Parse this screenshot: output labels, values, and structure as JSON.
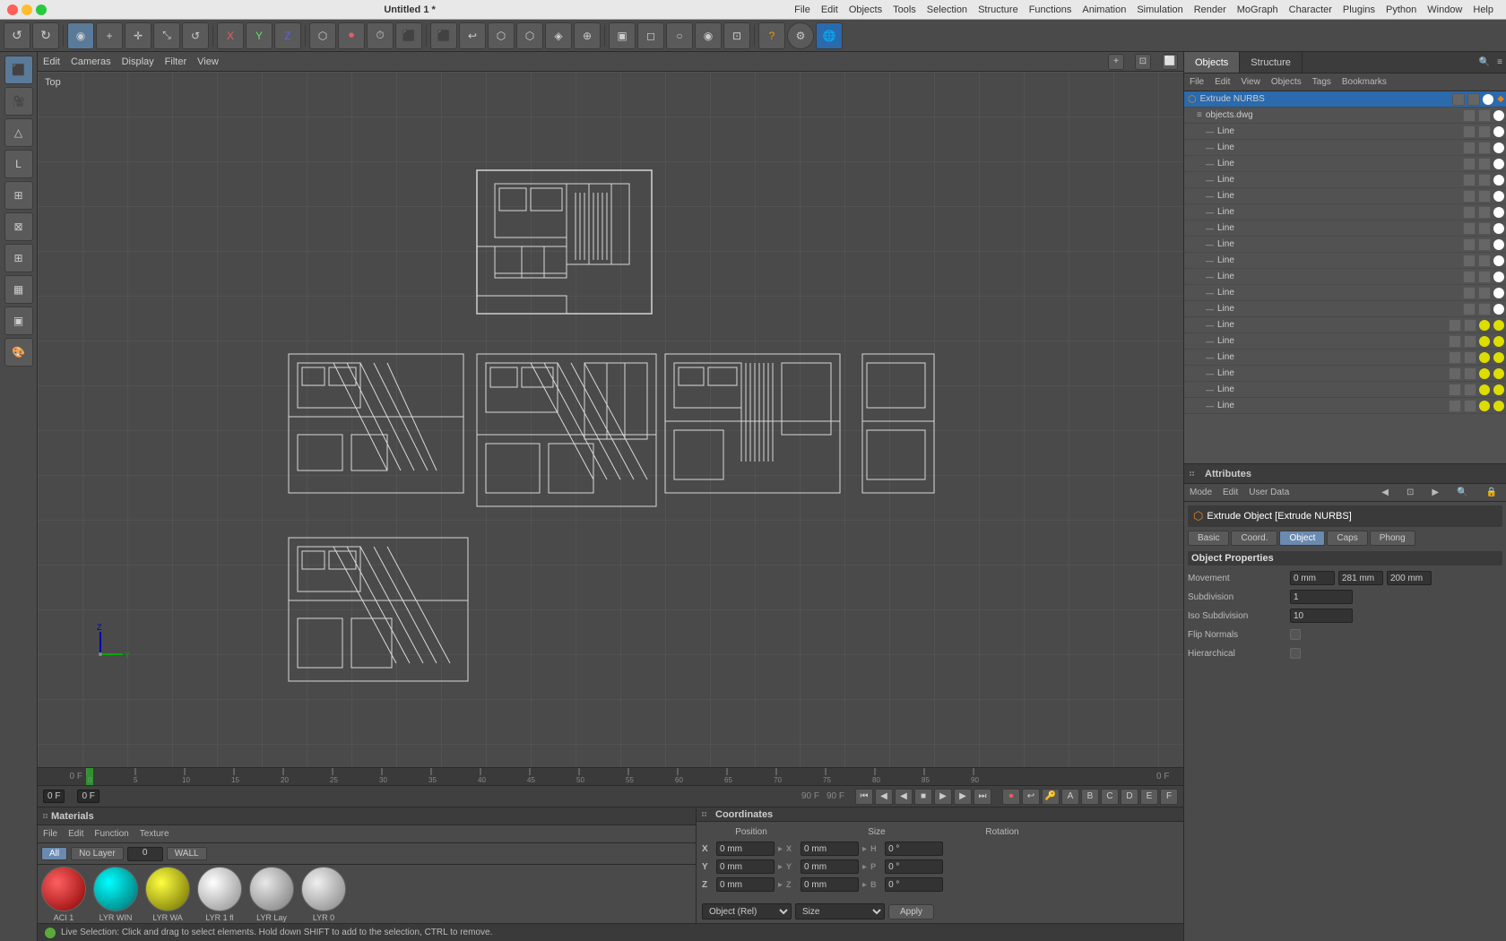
{
  "window": {
    "title": "Untitled 1 *",
    "close_label": "×",
    "minimize_label": "−",
    "maximize_label": "+"
  },
  "menu_bar": {
    "items": [
      "File",
      "Edit",
      "Objects",
      "Tools",
      "Selection",
      "Structure",
      "Functions",
      "Animation",
      "Simulation",
      "Render",
      "MoGraph",
      "Character",
      "Plugins",
      "Python",
      "Window",
      "Help"
    ]
  },
  "viewport": {
    "label": "Top",
    "toolbar_items": [
      "Edit",
      "Cameras",
      "Display",
      "Filter",
      "View"
    ]
  },
  "object_manager": {
    "tabs": [
      "Objects",
      "Structure"
    ],
    "menu_items": [
      "File",
      "Edit",
      "View",
      "Objects",
      "Tags",
      "Bookmarks"
    ],
    "root_item": "Extrude NURBS",
    "sub_item": "objects.dwg",
    "lines": [
      "Line",
      "Line",
      "Line",
      "Line",
      "Line",
      "Line",
      "Line",
      "Line",
      "Line",
      "Line",
      "Line",
      "Line",
      "Line",
      "Line",
      "Line",
      "Line",
      "Line",
      "Line"
    ]
  },
  "attributes": {
    "header": "Attributes",
    "menu_items": [
      "Mode",
      "Edit",
      "User Data"
    ],
    "object_title": "Extrude Object [Extrude NURBS]",
    "tabs": [
      "Basic",
      "Coord.",
      "Object",
      "Caps",
      "Phong"
    ],
    "active_tab": "Object",
    "section_title": "Object Properties",
    "movement_label": "Movement",
    "movement_x": "0 mm",
    "movement_y": "281 mm",
    "movement_z": "200 mm",
    "subdivision_label": "Subdivision",
    "subdivision_val": "1",
    "iso_subdivision_label": "Iso Subdivision",
    "iso_subdivision_val": "10",
    "flip_normals_label": "Flip Normals",
    "hierarchical_label": "Hierarchical"
  },
  "materials": {
    "header": "Materials",
    "menu_items": [
      "File",
      "Edit",
      "Function",
      "Texture"
    ],
    "filter_btns": [
      "All",
      "No Layer",
      "0",
      "WALL"
    ],
    "swatches": [
      {
        "label": "ACI 1",
        "color": "#cc2222",
        "type": "solid"
      },
      {
        "label": "LYR WIN",
        "color": "#00cccc",
        "type": "solid"
      },
      {
        "label": "LYR WA",
        "color": "#cccc00",
        "type": "solid"
      },
      {
        "label": "LYR 1 fl",
        "color": "#e0e0e0",
        "type": "shader"
      },
      {
        "label": "LYR Lay",
        "color": "#d0d0d0",
        "type": "shader"
      },
      {
        "label": "LYR 0",
        "color": "#f0f0f0",
        "type": "shader"
      }
    ]
  },
  "coordinates": {
    "header": "Coordinates",
    "col_headers": [
      "Position",
      "Size",
      "Rotation"
    ],
    "rows": [
      {
        "axis": "X",
        "pos": "0 mm",
        "size": "0 mm",
        "rot_label": "H",
        "rot": "0 °"
      },
      {
        "axis": "Y",
        "pos": "0 mm",
        "size": "0 mm",
        "rot_label": "P",
        "rot": "0 °"
      },
      {
        "axis": "Z",
        "pos": "0 mm",
        "size": "0 mm",
        "rot_label": "B",
        "rot": "0 °"
      }
    ],
    "dropdown1_val": "Object (Rel)",
    "dropdown2_val": "Size",
    "apply_btn": "Apply"
  },
  "timeline": {
    "start": "0 F",
    "end": "90 F",
    "ticks": [
      "0",
      "5",
      "10",
      "15",
      "20",
      "25",
      "30",
      "35",
      "40",
      "45",
      "50",
      "55",
      "60",
      "65",
      "70",
      "75",
      "80",
      "85",
      "90"
    ],
    "current": "0 F",
    "fps": "90 F"
  },
  "playback": {
    "frame_start": "0 F",
    "frame_current": "0 F",
    "frame_end": "90 F",
    "fps_label": "90 F"
  },
  "status_bar": {
    "message": "Live Selection: Click and drag to select elements. Hold down SHIFT to add to the selection, CTRL to remove."
  },
  "icons": {
    "extrude_nurbs": "⬡",
    "object_dwg": "📄",
    "line": "—",
    "grip": "⋮⋮",
    "move": "✛",
    "rotate": "↺",
    "scale": "⤡",
    "select": "▣",
    "live_sel": "◉",
    "poly_sel": "◻",
    "loop_sel": "○",
    "arrow": "↖",
    "play": "▶",
    "stop": "■",
    "prev_key": "⏮",
    "next_key": "⏭",
    "prev_frame": "◀",
    "next_frame": "▶"
  }
}
